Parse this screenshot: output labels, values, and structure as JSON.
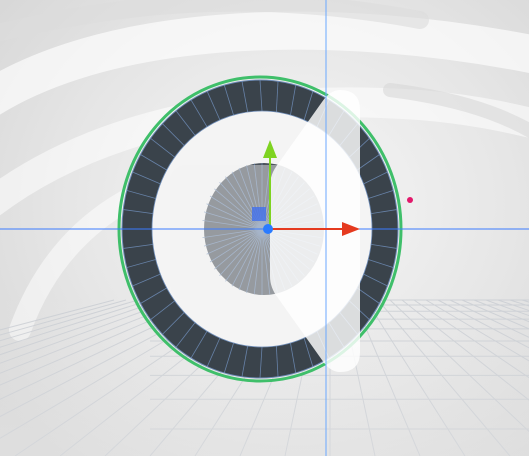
{
  "viewport": {
    "background_color": "#e8e8e8",
    "swirl_color": "#ffffff",
    "floor_grid_color": "#c8ccd2",
    "axis_x_color": "#3b7bff",
    "axis_y_color": "#6aa8ff"
  },
  "model": {
    "ring_outer_color": "#3a434b",
    "ring_inner_color": "#ffffff",
    "hub_color": "#4b535b",
    "wire_color": "#6f8db8",
    "outline_color": "#3fbf6a",
    "back_panel_color": "#f2f2f2",
    "icon_panel_color": "#ffffff"
  },
  "gizmo": {
    "up_axis_color": "#7ed321",
    "right_axis_color": "#e53a1f",
    "center_color": "#2a7bff",
    "plane_handle_color": "#3b6cf0",
    "marker_color": "#e2196b"
  }
}
